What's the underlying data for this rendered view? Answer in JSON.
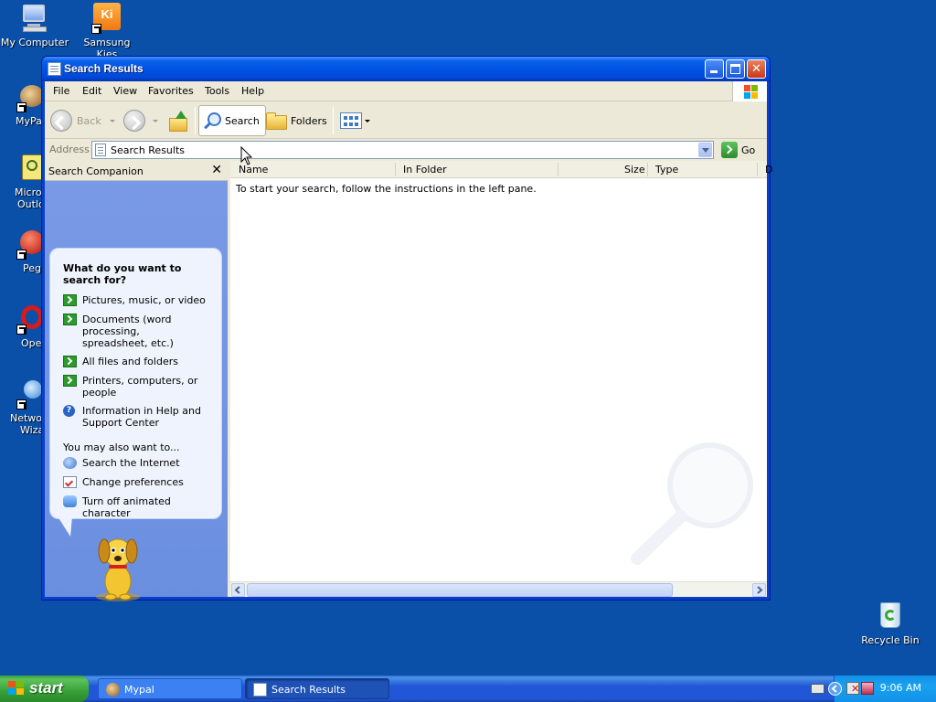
{
  "desktop": {
    "icons": [
      {
        "label": "My Computer"
      },
      {
        "label": "Samsung Kies",
        "glyph": "Ki"
      },
      {
        "label": "MyPa"
      },
      {
        "label": "Micros",
        "label2": "Outlo"
      },
      {
        "label": "Peg"
      },
      {
        "label": "Ope"
      },
      {
        "label": "Networ",
        "label2": "Wiza"
      },
      {
        "label": "Recycle Bin"
      }
    ]
  },
  "window": {
    "title": "Search Results",
    "menu": [
      "File",
      "Edit",
      "View",
      "Favorites",
      "Tools",
      "Help"
    ],
    "toolbar": {
      "back": "Back",
      "search": "Search",
      "folders": "Folders"
    },
    "address": {
      "label": "Address",
      "value": "Search Results",
      "go": "Go"
    }
  },
  "companion": {
    "header": "Search Companion",
    "close_glyph": "✕",
    "question": "What do you want to search for?",
    "options": [
      {
        "icon": "green-arrow-icon",
        "label": "Pictures, music, or video"
      },
      {
        "icon": "green-arrow-icon",
        "label": "Documents (word processing, spreadsheet, etc.)"
      },
      {
        "icon": "green-arrow-icon",
        "label": "All files and folders"
      },
      {
        "icon": "green-arrow-icon",
        "label": "Printers, computers, or people"
      },
      {
        "icon": "help-icon",
        "label": "Information in Help and Support Center"
      }
    ],
    "also_heading": "You may also want to...",
    "also": [
      {
        "icon": "internet-search-icon",
        "label": "Search the Internet"
      },
      {
        "icon": "preferences-icon",
        "label": "Change preferences"
      },
      {
        "icon": "animated-character-icon",
        "label": "Turn off animated character"
      }
    ],
    "help_glyph": "?"
  },
  "results": {
    "columns": [
      "Name",
      "In Folder",
      "Size",
      "Type",
      "D"
    ],
    "message": "To start your search, follow the instructions in the left pane."
  },
  "taskbar": {
    "start": "start",
    "tasks": [
      {
        "label": "Mypal",
        "active": false
      },
      {
        "label": "Search Results",
        "active": true
      }
    ],
    "clock": "9:06 AM"
  },
  "colors": {
    "desktop": "#0a4fa8",
    "titlebar": "#0054e3",
    "companion": "#7a9ae6",
    "start": "#36a036"
  }
}
